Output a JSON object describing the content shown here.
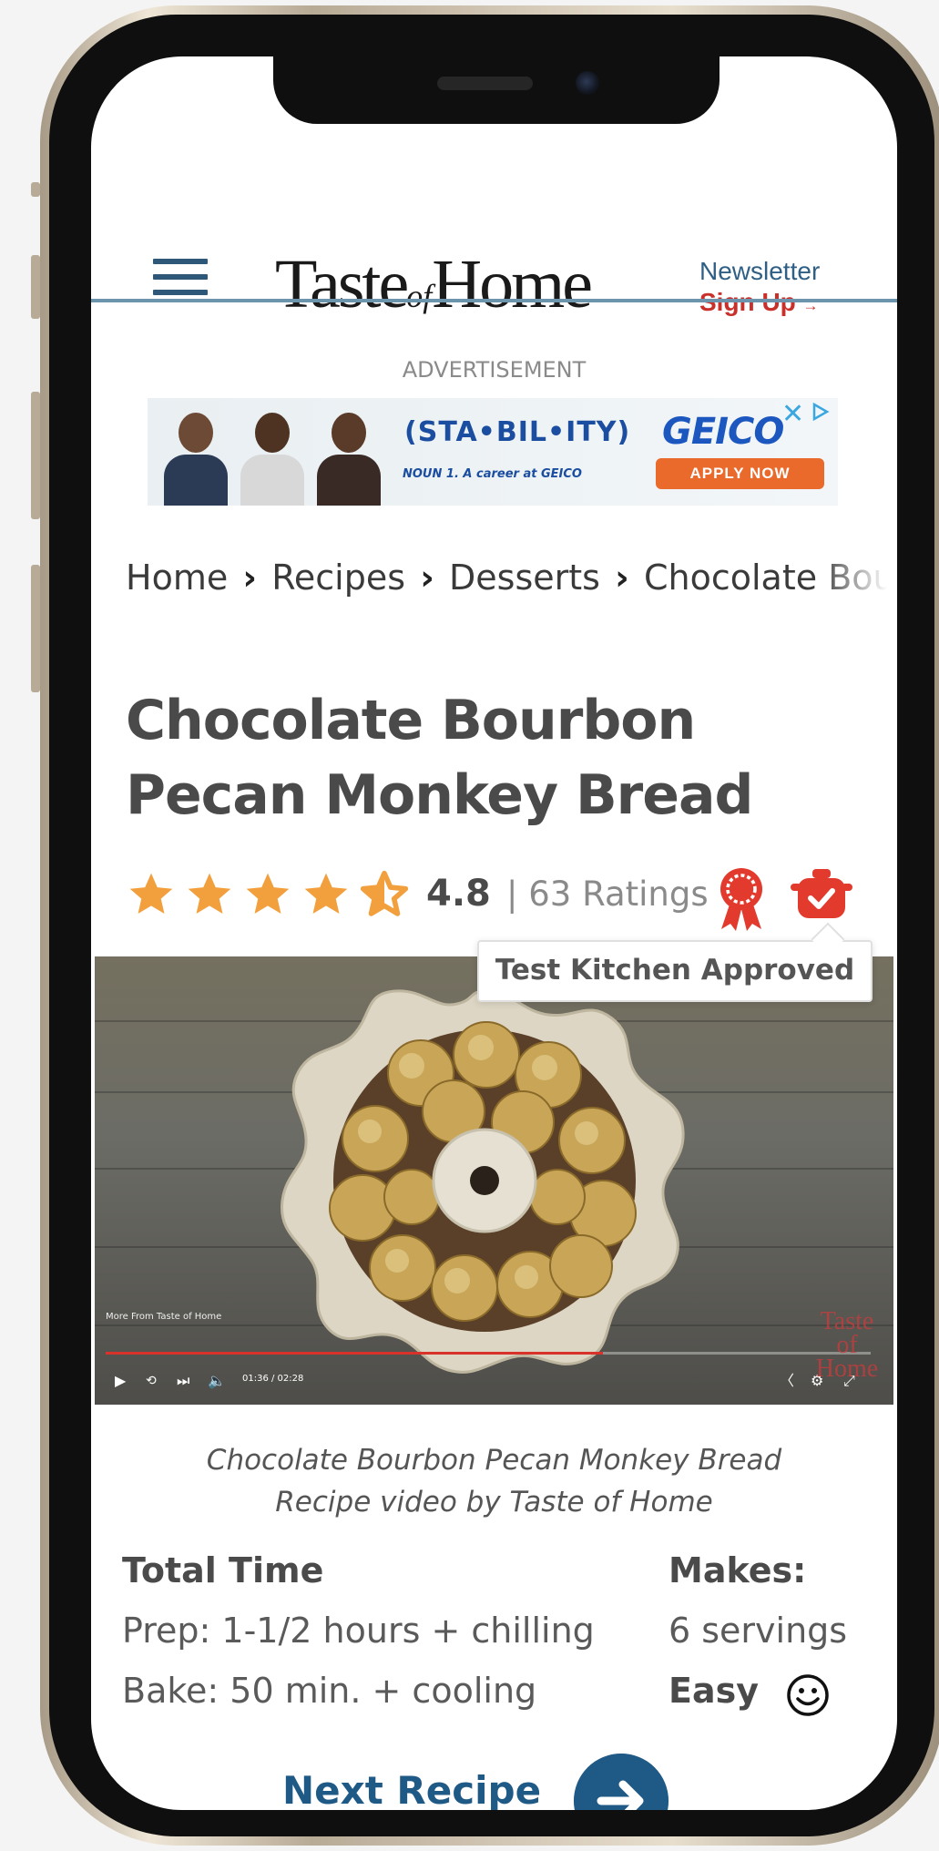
{
  "header": {
    "logo_text_a": "Taste",
    "logo_text_of": "of",
    "logo_text_b": "Home",
    "newsletter_label": "Newsletter",
    "signup_label": "Sign Up",
    "signup_arrow": "→"
  },
  "ad": {
    "label": "ADVERTISEMENT",
    "headline": "(STA•BIL•ITY)",
    "subline": "NOUN 1. A career at GEICO",
    "brand": "GEICO",
    "cta": "APPLY NOW",
    "close_glyph": "✕"
  },
  "breadcrumb": {
    "items": [
      "Home",
      "Recipes",
      "Desserts",
      "Chocolate Bourbon Pecan Monkey Bread"
    ],
    "separator": "›"
  },
  "recipe": {
    "title": "Chocolate Bourbon Pecan Monkey Bread",
    "rating_value": "4.8",
    "rating_count": "| 63 Ratings",
    "rating_out_of": 5,
    "tooltip": "Test Kitchen Approved"
  },
  "video": {
    "more_label": "More From Taste of Home",
    "time": "01:36 / 02:28",
    "progress_fraction": 0.65,
    "watermark": "Taste of Home"
  },
  "caption": {
    "line1": "Chocolate Bourbon Pecan Monkey Bread",
    "line2": "Recipe video by Taste of Home"
  },
  "stats": {
    "total_time_label": "Total Time",
    "prep": "Prep:  1-1/2 hours + chilling",
    "bake": "Bake:  50 min. + cooling",
    "makes_label": "Makes:",
    "servings": "6 servings",
    "difficulty": "Easy"
  },
  "next": {
    "label": "Next Recipe"
  },
  "colors": {
    "brand_blue": "#1f5a86",
    "accent_red": "#c9302a",
    "star_orange": "#f2a03d",
    "rule_blue": "#6d94ad"
  },
  "icons": {
    "menu": "hamburger-icon",
    "stars": "star-icon",
    "award": "award-ribbon-icon",
    "test_kitchen": "test-kitchen-pot-icon",
    "next": "arrow-right-icon",
    "difficulty": "smiley-icon"
  }
}
